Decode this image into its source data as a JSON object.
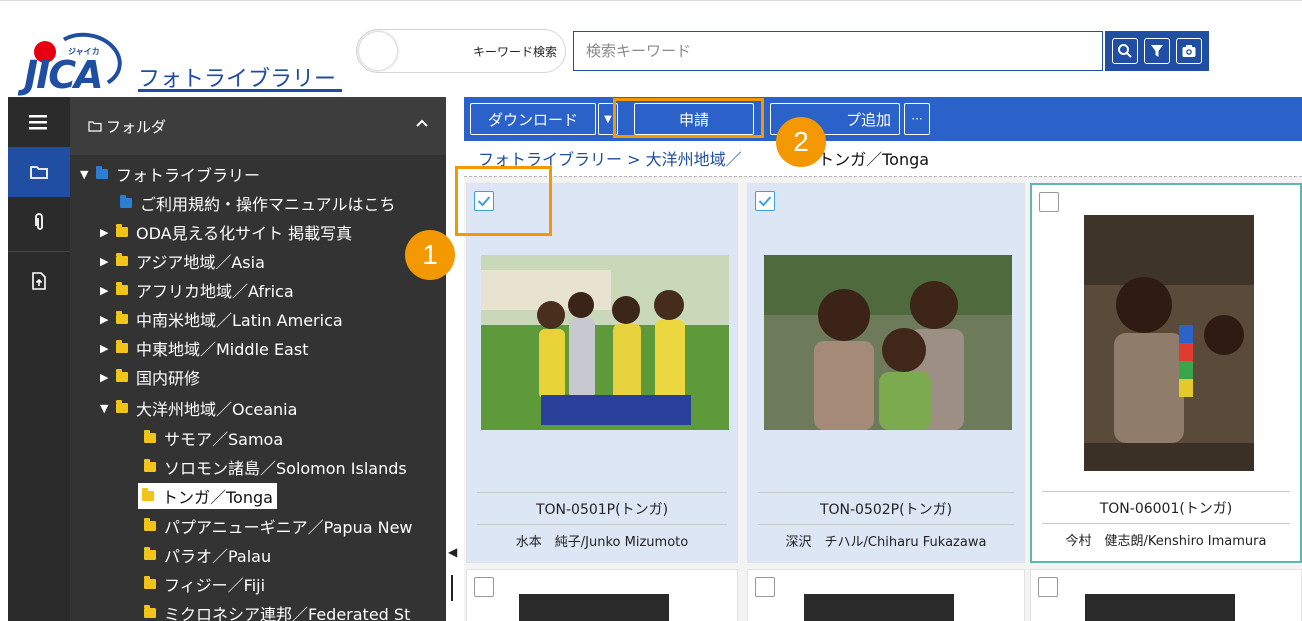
{
  "header": {
    "logo_text": "JICA",
    "logo_sub": "ジャイカ",
    "app_title": "フォトライブラリー",
    "toggle_label": "キーワード検索",
    "search_placeholder": "検索キーワード",
    "search_buttons": [
      "search-icon",
      "filter-icon",
      "camera-icon"
    ],
    "accent_color": "#1f4ea3"
  },
  "rail": {
    "items": [
      "menu-icon",
      "folder-icon",
      "clip-icon",
      "upload-icon"
    ]
  },
  "tree": {
    "header_label": "フォルダ",
    "items": [
      {
        "label": "フォトライブラリー",
        "expanded": true,
        "icon": "folder-blue"
      },
      {
        "label": "ご利用規約・操作マニュアルはこち",
        "icon": "folder-blue"
      },
      {
        "label": "ODA見える化サイト 掲載写真",
        "expanded": false
      },
      {
        "label": "アジア地域／Asia",
        "expanded": false
      },
      {
        "label": "アフリカ地域／Africa",
        "expanded": false
      },
      {
        "label": "中南米地域／Latin America",
        "expanded": false
      },
      {
        "label": "中東地域／Middle East",
        "expanded": false
      },
      {
        "label": "国内研修",
        "expanded": false
      },
      {
        "label": "大洋州地域／Oceania",
        "expanded": true
      },
      {
        "label": "サモア／Samoa"
      },
      {
        "label": "ソロモン諸島／Solomon Islands"
      },
      {
        "label": "トンガ／Tonga",
        "selected": true
      },
      {
        "label": "パプアニューギニア／Papua New"
      },
      {
        "label": "パラオ／Palau"
      },
      {
        "label": "フィジー／Fiji"
      },
      {
        "label": "ミクロネシア連邦／Federated St"
      }
    ]
  },
  "toolbar": {
    "download_label": "ダウンロード",
    "apply_label": "申請",
    "group_add_label": "プ追加",
    "more_label": "···"
  },
  "breadcrumb": {
    "root": "フォトライブラリー",
    "sep": ">",
    "region": "大洋州地域／",
    "current": "トンガ／Tonga"
  },
  "photos": [
    {
      "code": "TON-0501P(トンガ)",
      "credit": "水本　純子/Junko Mizumoto",
      "checked": true
    },
    {
      "code": "TON-0502P(トンガ)",
      "credit": "深沢　チハル/Chiharu Fukazawa",
      "checked": true
    },
    {
      "code": "TON-06001(トンガ)",
      "credit": "今村　健志朗/Kenshiro Imamura",
      "checked": false
    }
  ],
  "annotations": {
    "badge1": "1",
    "badge2": "2",
    "highlight_color": "#f39800"
  }
}
